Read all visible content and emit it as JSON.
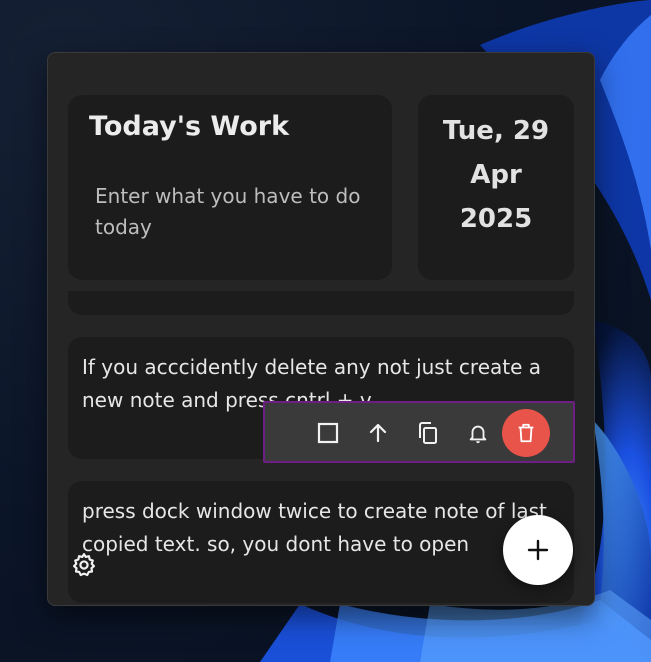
{
  "header": {
    "title": "Today's Work",
    "input_placeholder": "Enter what you have to do today"
  },
  "date": {
    "line1": "Tue, 29",
    "line2": "Apr",
    "line3": "2025"
  },
  "notes": [
    {
      "text": "If you acccidently delete any not just create a new note and press cntrl + v"
    },
    {
      "text": "press dock window twice to create note of last copied text. so, you dont have to open"
    }
  ],
  "toolbar": {
    "icons": [
      "square-icon",
      "arrow-up-icon",
      "copy-icon",
      "bell-icon",
      "trash-icon"
    ],
    "accent_border": "#6d1f86",
    "delete_color": "#e8544a"
  },
  "controls": {
    "settings_icon": "gear-icon",
    "add_icon": "plus-icon"
  }
}
